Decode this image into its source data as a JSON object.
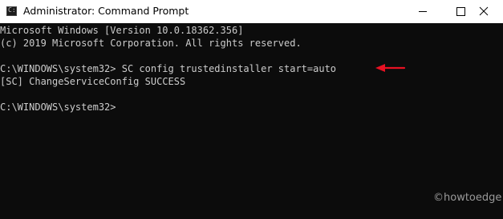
{
  "window": {
    "title": "Administrator: Command Prompt",
    "icon": "cmd-icon"
  },
  "controls": {
    "minimize_icon": "minimize-icon",
    "maximize_icon": "maximize-icon",
    "close_icon": "close-icon"
  },
  "console": {
    "lines": [
      "Microsoft Windows [Version 10.0.18362.356]",
      "(c) 2019 Microsoft Corporation. All rights reserved.",
      "C:\\WINDOWS\\system32> SC config trustedinstaller start=auto",
      "[SC] ChangeServiceConfig SUCCESS",
      "C:\\WINDOWS\\system32>"
    ],
    "text_color": "#cccccc",
    "background": "#0c0c0c"
  },
  "annotation": {
    "arrow_color": "#e81123",
    "arrow_icon": "red-arrow-icon"
  },
  "watermark": "©howtoedge"
}
